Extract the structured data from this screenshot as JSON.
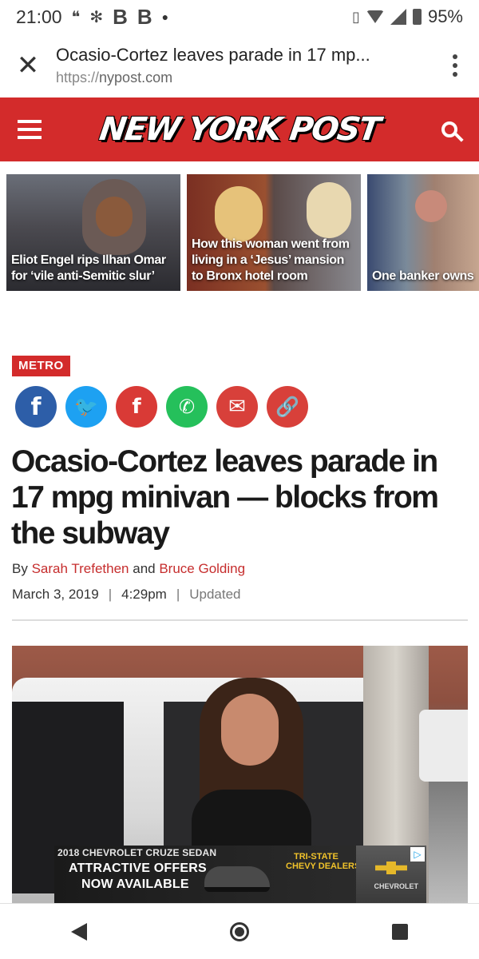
{
  "status_bar": {
    "time": "21:00",
    "battery": "95%",
    "icons": [
      "hangouts-icon",
      "pinwheel-icon",
      "b-icon",
      "b-icon",
      "dot-icon",
      "vibrate-icon",
      "wifi-icon",
      "signal-icon",
      "battery-icon"
    ]
  },
  "browser": {
    "title": "Ocasio-Cortez leaves parade in 17 mp...",
    "url_scheme": "https://",
    "url_host": "nypost.com"
  },
  "header": {
    "logo": "NEW YORK POST",
    "brand_color": "#d32b2b"
  },
  "stories": [
    {
      "caption": "Eliot Engel rips Ilhan Omar for ‘vile anti-Semitic slur’"
    },
    {
      "caption": "How this woman went from living in a ‘Jesus’ mansion to Bronx hotel room"
    },
    {
      "caption": "One banker owns buildings housing Flushing’s alleged"
    }
  ],
  "article": {
    "section": "METRO",
    "share": {
      "facebook": "f",
      "twitter": "🐦",
      "flipboard": "f",
      "whatsapp": "✆",
      "email": "✉",
      "link": "🔗"
    },
    "headline": "Ocasio-Cortez leaves parade in 17 mpg minivan — blocks from the subway",
    "by": "By",
    "author1": "Sarah Trefethen",
    "and": "and",
    "author2": "Bruce Golding",
    "date": "March 3, 2019",
    "sep1": "|",
    "time": "4:29pm",
    "sep2": "|",
    "updated": "Updated"
  },
  "ad": {
    "model": "2018 CHEVROLET CRUZE SEDAN",
    "offer_line1": "ATTRACTIVE OFFERS",
    "offer_line2": "NOW AVAILABLE",
    "dealer_line1": "TRI-STATE",
    "dealer_line2": "CHEVY DEALERS",
    "brand": "CHEVROLET",
    "adchoice": "▷"
  }
}
